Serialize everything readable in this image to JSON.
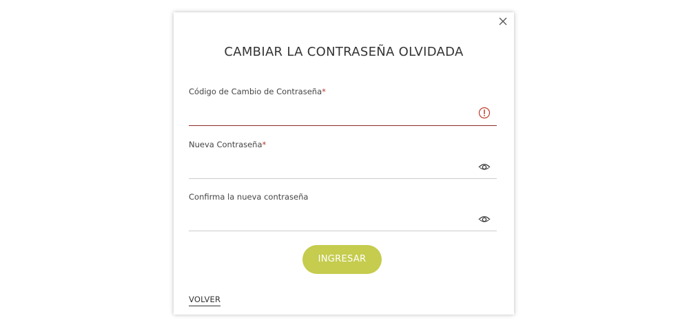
{
  "dialog": {
    "title": "CAMBIAR LA CONTRASEÑA OLVIDADA",
    "close_icon": "close-icon"
  },
  "form": {
    "fields": [
      {
        "label": "Código de Cambio de Contraseña",
        "required_mark": "*",
        "value": "",
        "state": "error",
        "icon": "alert-circle-icon"
      },
      {
        "label": "Nueva Contraseña",
        "required_mark": "*",
        "value": "",
        "state": "normal",
        "icon": "eye-icon"
      },
      {
        "label": "Confirma la nueva contraseña",
        "required_mark": "",
        "value": "",
        "state": "normal",
        "icon": "eye-icon"
      }
    ],
    "submit_label": "INGRESAR",
    "back_label": "VOLVER"
  },
  "colors": {
    "accent": "#c5cc4e",
    "error": "#b03a2e",
    "error_border": "#8b2a22",
    "text": "#333333",
    "divider": "#cccccc"
  }
}
